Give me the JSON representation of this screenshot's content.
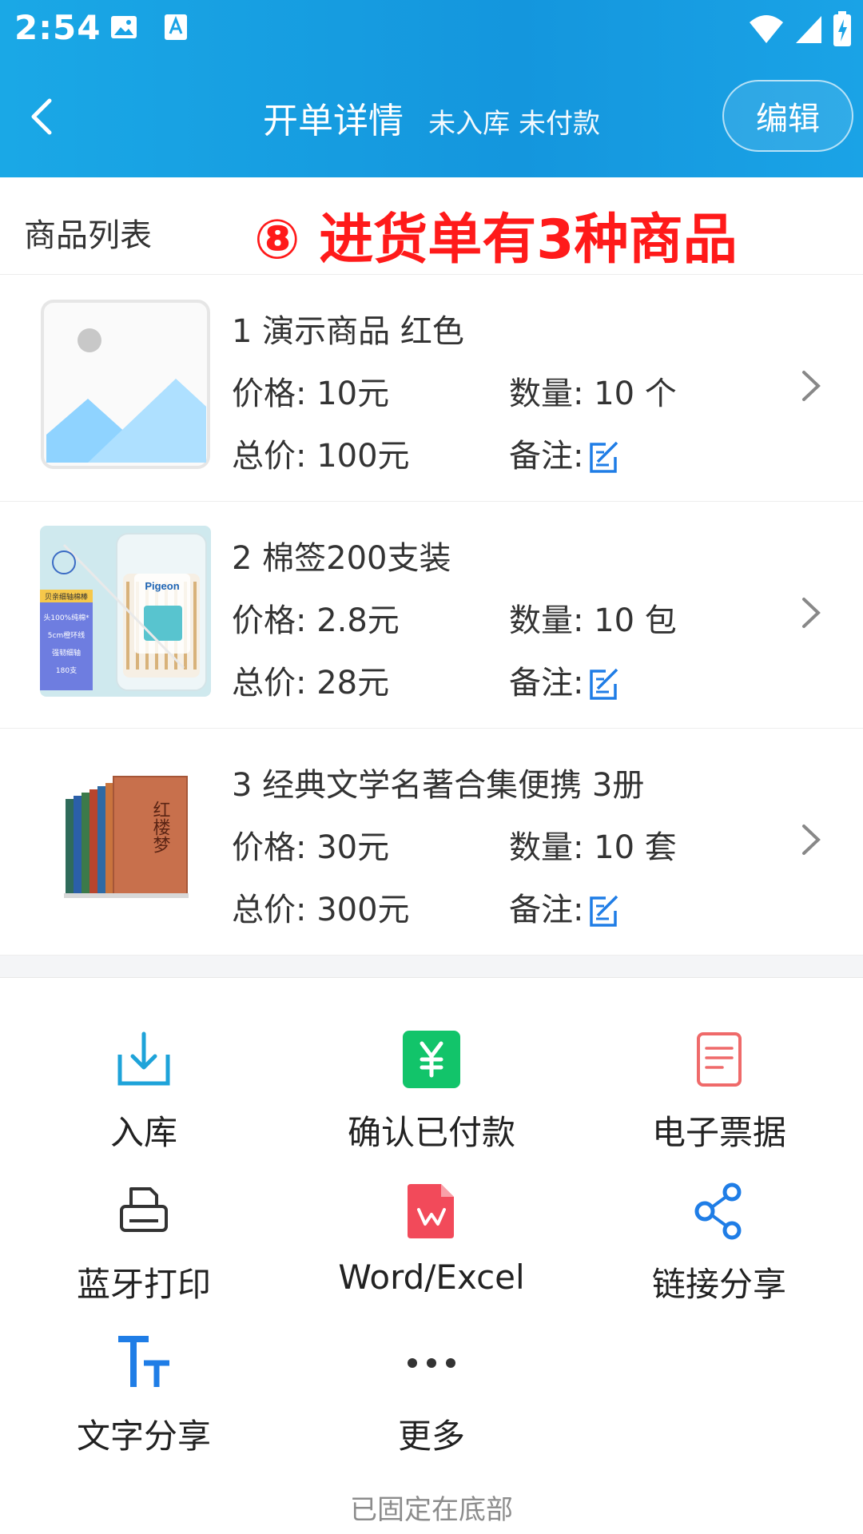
{
  "status_bar": {
    "time": "2:54"
  },
  "header": {
    "title": "开单详情",
    "status": "未入库  未付款",
    "edit_label": "编辑"
  },
  "list": {
    "title": "商品列表",
    "annotation": "⑧ 进货单有3种商品",
    "items": [
      {
        "name": "1 演示商品 红色",
        "price": "价格: 10元",
        "quantity": "数量: 10 个",
        "total": "总价: 100元",
        "note_label": "备注:",
        "thumbnail_icon": "image-placeholder-icon"
      },
      {
        "name": "2 棉签200支装",
        "price": "价格: 2.8元",
        "quantity": "数量: 10 包",
        "total": "总价: 28元",
        "note_label": "备注:",
        "thumbnail_icon": "cotton-swab-product-photo",
        "thumbnail_text": {
          "brand": "Pigeon",
          "lines": [
            "贝亲细轴棉棒",
            "头100%纯棉*",
            "5cm橙环线",
            "强韧细轴",
            "180支"
          ]
        }
      },
      {
        "name": "3 经典文学名著合集便携 3册",
        "price": "价格: 30元",
        "quantity": "数量: 10 套",
        "total": "总价: 300元",
        "note_label": "备注:",
        "thumbnail_icon": "book-set-photo",
        "thumbnail_text": {
          "cover_title": "红楼梦"
        }
      }
    ]
  },
  "actions": [
    {
      "label": "入库",
      "icon": "warehouse-in-icon"
    },
    {
      "label": "确认已付款",
      "icon": "yuan-payment-icon"
    },
    {
      "label": "电子票据",
      "icon": "receipt-document-icon"
    },
    {
      "label": "蓝牙打印",
      "icon": "printer-icon"
    },
    {
      "label": "Word/Excel",
      "icon": "wps-office-icon"
    },
    {
      "label": "链接分享",
      "icon": "share-link-icon"
    },
    {
      "label": "文字分享",
      "icon": "text-share-icon"
    },
    {
      "label": "更多",
      "icon": "more-dots-icon"
    }
  ],
  "footer": {
    "pinned_note": "已固定在底部"
  },
  "colors": {
    "header_blue": "#1aa8e6",
    "annotation_red": "#ff1a1a",
    "note_icon_blue": "#1f7de6",
    "payment_green": "#12c46a",
    "receipt_red": "#ef6a6a",
    "wps_red": "#f24a5a"
  }
}
